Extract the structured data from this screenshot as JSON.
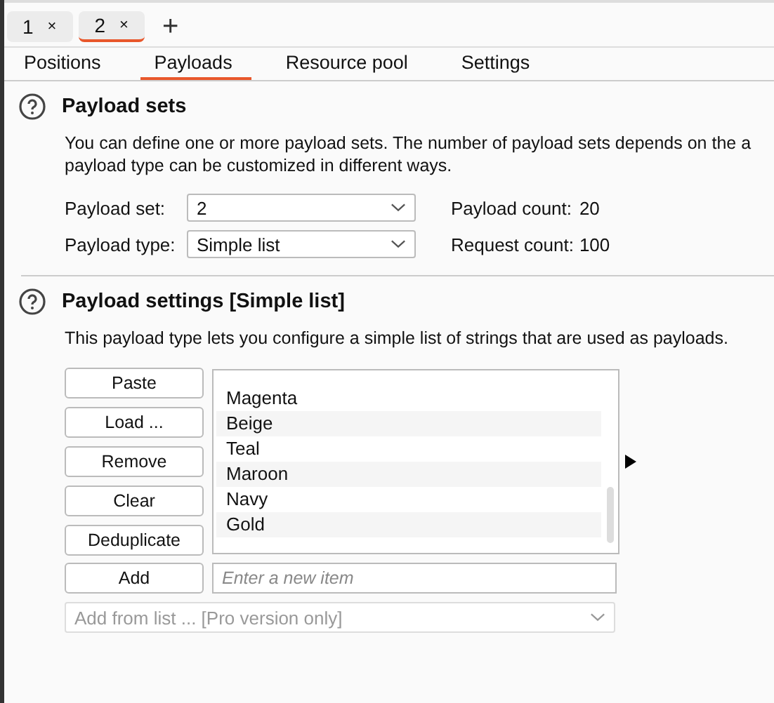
{
  "top_tabs": [
    {
      "label": "1",
      "close": "×",
      "selected": false
    },
    {
      "label": "2",
      "close": "×",
      "selected": true
    }
  ],
  "new_tab": "+",
  "tabs": [
    {
      "label": "Positions",
      "selected": false
    },
    {
      "label": "Payloads",
      "selected": true
    },
    {
      "label": "Resource pool",
      "selected": false
    },
    {
      "label": "Settings",
      "selected": false
    }
  ],
  "payload_sets": {
    "title": "Payload sets",
    "description_lines": [
      "You can define one or more payload sets. The number of payload sets depends on the a",
      "payload type can be customized in different ways."
    ],
    "payload_set_label": "Payload set:",
    "payload_set_value": "2",
    "payload_type_label": "Payload type:",
    "payload_type_value": "Simple list",
    "payload_count_label": "Payload count:",
    "payload_count": "20",
    "request_count_label": "Request count:",
    "request_count": "100"
  },
  "payload_settings": {
    "title": "Payload settings [Simple list]",
    "description": "This payload type lets you configure a simple list of strings that are used as payloads.",
    "buttons": [
      "Paste",
      "Load ...",
      "Remove",
      "Clear",
      "Deduplicate"
    ],
    "items": [
      "Magenta",
      "Beige",
      "Teal",
      "Maroon",
      "Navy",
      "Gold"
    ],
    "add_button": "Add",
    "new_item": {
      "placeholder": "Enter a new item"
    },
    "add_from_list": {
      "value": "Add from list ... [Pro version only]",
      "disabled": true
    }
  }
}
